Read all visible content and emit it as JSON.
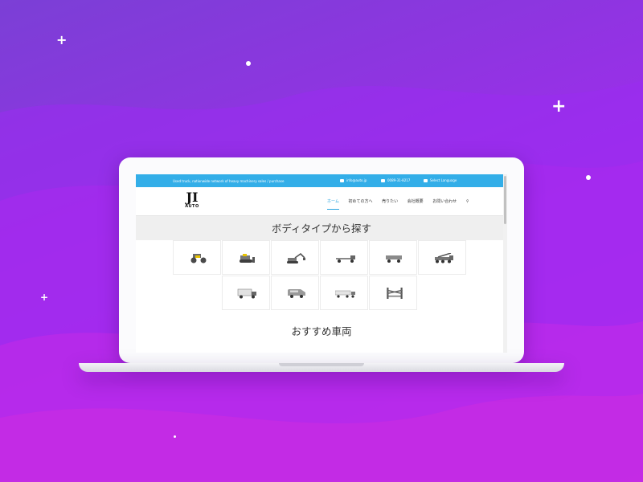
{
  "colors": {
    "background_start": "#7b3fd6",
    "background_end": "#b52ff0",
    "topbar": "#33aee8",
    "nav_active": "#29a3de"
  },
  "site": {
    "topbar": {
      "tagline": "Used truck, nationwide network of heavy machinery sales / purchase",
      "email": "info@auto.jp",
      "phone": "0089-31-8217",
      "language": "Select Language"
    },
    "logo": {
      "mark": "JI",
      "word": "AUTO"
    },
    "nav": {
      "items": [
        "ホーム",
        "初めての方へ",
        "売りたい",
        "会社概要",
        "お問い合わせ"
      ],
      "active_index": 0,
      "search_icon": "search-icon"
    },
    "section_title": "ボディタイプから探す",
    "vehicle_tiles": [
      {
        "icon": "road-roller-icon"
      },
      {
        "icon": "bulldozer-icon"
      },
      {
        "icon": "excavator-icon"
      },
      {
        "icon": "flatbed-truck-icon"
      },
      {
        "icon": "dump-trailer-icon"
      },
      {
        "icon": "crane-truck-icon"
      },
      {
        "icon": "box-truck-icon"
      },
      {
        "icon": "van-icon"
      },
      {
        "icon": "trailer-truck-icon"
      },
      {
        "icon": "forklift-icon"
      }
    ],
    "recommended_title": "おすすめ車両"
  }
}
